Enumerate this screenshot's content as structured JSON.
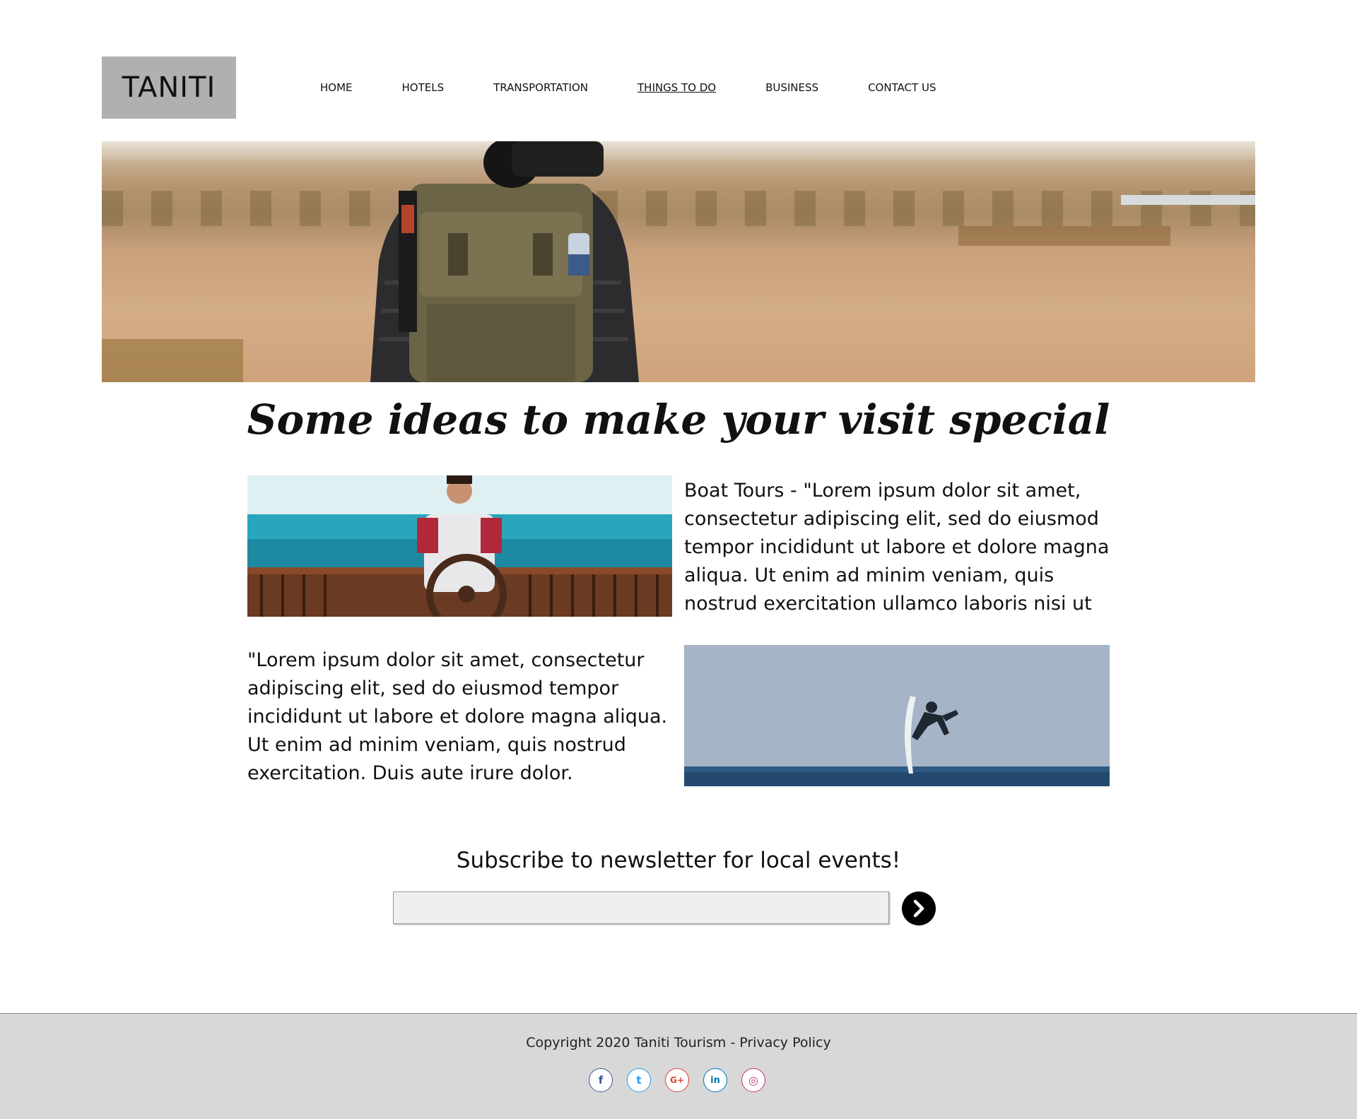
{
  "header": {
    "logo_text": "TANITI",
    "nav": [
      {
        "label": "HOME"
      },
      {
        "label": "HOTELS"
      },
      {
        "label": "TRANSPORTATION"
      },
      {
        "label": "THINGS TO DO"
      },
      {
        "label": "BUSINESS"
      },
      {
        "label": "CONTACT US"
      }
    ],
    "active_nav": "THINGS TO DO"
  },
  "main": {
    "section_title": "Some ideas to make your visit special",
    "features": [
      {
        "text": "Boat Tours - \"Lorem ipsum dolor sit amet, consectetur adipiscing elit, sed do eiusmod tempor incididunt ut labore et dolore magna aliqua. Ut enim ad minim veniam, quis nostrud exercitation ullamco laboris nisi ut"
      },
      {
        "text": "\"Lorem ipsum dolor sit amet, consectetur adipiscing elit, sed do eiusmod tempor incididunt ut labore et dolore magna aliqua. Ut enim ad minim veniam, quis nostrud exercitation. Duis aute irure dolor."
      }
    ]
  },
  "newsletter": {
    "title": "Subscribe to newsletter for local events!",
    "input_value": "",
    "submit_icon": "chevron-right-icon"
  },
  "footer": {
    "copyright": "Copyright 2020 Taniti Tourism ",
    "separator": " - ",
    "privacy_link": "Privacy Policy",
    "social": [
      {
        "icon": "facebook-icon",
        "glyph": "f",
        "color": "#3b5998"
      },
      {
        "icon": "twitter-icon",
        "glyph": "t",
        "color": "#1da1f2"
      },
      {
        "icon": "google-plus-icon",
        "glyph": "G+",
        "color": "#db4437"
      },
      {
        "icon": "linkedin-icon",
        "glyph": "in",
        "color": "#0077b5"
      },
      {
        "icon": "instagram-icon",
        "glyph": "◎",
        "color": "#c13584"
      }
    ]
  },
  "colors": {
    "logo_bg": "#b0b0b0",
    "footer_bg": "#d8d8d8",
    "input_bg": "#efefef",
    "button_bg": "#000000"
  }
}
